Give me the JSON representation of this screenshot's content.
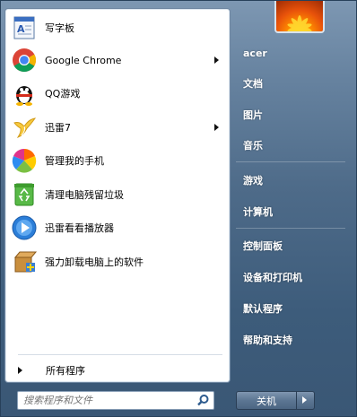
{
  "programs": [
    {
      "label": "写字板",
      "icon": "wordpad-icon",
      "submenu": false
    },
    {
      "label": "Google Chrome",
      "icon": "chrome-icon",
      "submenu": true
    },
    {
      "label": "QQ游戏",
      "icon": "qq-icon",
      "submenu": false
    },
    {
      "label": "迅雷7",
      "icon": "thunder-icon",
      "submenu": true
    },
    {
      "label": "管理我的手机",
      "icon": "phone-manager-icon",
      "submenu": false
    },
    {
      "label": "清理电脑残留垃圾",
      "icon": "recycle-icon",
      "submenu": false
    },
    {
      "label": "迅雷看看播放器",
      "icon": "xunlei-player-icon",
      "submenu": false
    },
    {
      "label": "强力卸载电脑上的软件",
      "icon": "uninstall-icon",
      "submenu": false
    }
  ],
  "all_programs": "所有程序",
  "search": {
    "placeholder": "搜索程序和文件"
  },
  "right": {
    "user": "acer",
    "items": [
      "文档",
      "图片",
      "音乐",
      "游戏",
      "计算机",
      "控制面板",
      "设备和打印机",
      "默认程序",
      "帮助和支持"
    ]
  },
  "shutdown_label": "关机",
  "colors": {
    "chrome_red": "#db4437",
    "chrome_green": "#0f9d58",
    "chrome_yellow": "#f4b400",
    "chrome_blue": "#4285f4"
  }
}
